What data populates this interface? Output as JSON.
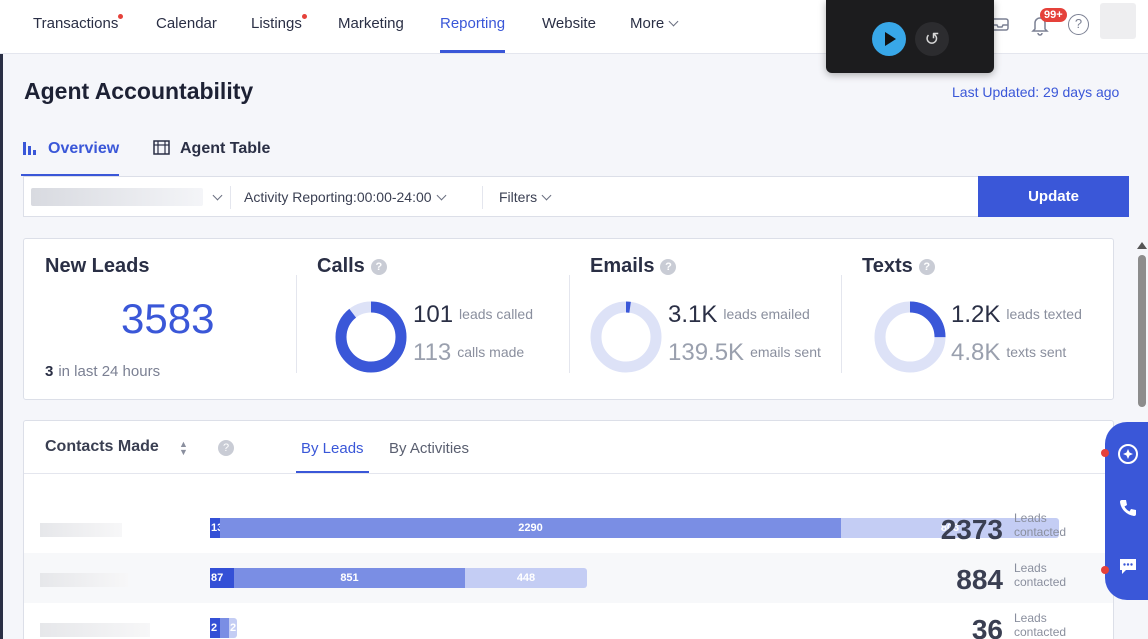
{
  "nav": {
    "items": [
      {
        "label": "Transactions",
        "dot": true
      },
      {
        "label": "Calendar",
        "dot": false
      },
      {
        "label": "Listings",
        "dot": true
      },
      {
        "label": "Marketing",
        "dot": false
      },
      {
        "label": "Reporting",
        "dot": false
      },
      {
        "label": "Website",
        "dot": false
      },
      {
        "label": "More",
        "dot": false
      }
    ],
    "active": "Reporting",
    "notification_badge": "99+"
  },
  "page": {
    "title": "Agent Accountability",
    "last_updated": "Last Updated: 29 days ago"
  },
  "tabs": [
    {
      "label": "Overview",
      "icon": "bar-chart-icon",
      "active": true
    },
    {
      "label": "Agent Table",
      "icon": "table-icon",
      "active": false
    }
  ],
  "filters": {
    "activity": "Activity Reporting:00:00-24:00",
    "filters_label": "Filters",
    "update_label": "Update"
  },
  "stats": {
    "new_leads": {
      "title": "New Leads",
      "value": "3583",
      "last24_count": "3",
      "last24_label": "in last 24 hours"
    },
    "calls": {
      "title": "Calls",
      "primary": "101",
      "primary_label": "leads called",
      "secondary": "113",
      "secondary_label": "calls made",
      "fraction": 0.894
    },
    "emails": {
      "title": "Emails",
      "primary": "3.1K",
      "primary_label": "leads emailed",
      "secondary": "139.5K",
      "secondary_label": "emails sent",
      "fraction": 0.022
    },
    "texts": {
      "title": "Texts",
      "primary": "1.2K",
      "primary_label": "leads texted",
      "secondary": "4.8K",
      "secondary_label": "texts sent",
      "fraction": 0.25
    }
  },
  "contacts": {
    "title": "Contacts Made",
    "tab_leads": "By Leads",
    "tab_activities": "By Activities",
    "rows_label": "Leads contacted",
    "rows": [
      {
        "s1": "13",
        "s2": "2290",
        "s3": "803",
        "total": "2373"
      },
      {
        "s1": "87",
        "s2": "851",
        "s3": "448",
        "total": "884"
      },
      {
        "s1": "2",
        "s2": "",
        "s3": "2",
        "total": "36"
      }
    ]
  },
  "colors": {
    "accent": "#3a57d8",
    "alert": "#e5413a",
    "bar_dark": "#3450d6",
    "bar_mid": "#7a8ee4",
    "bar_light": "#c4cdf4"
  }
}
